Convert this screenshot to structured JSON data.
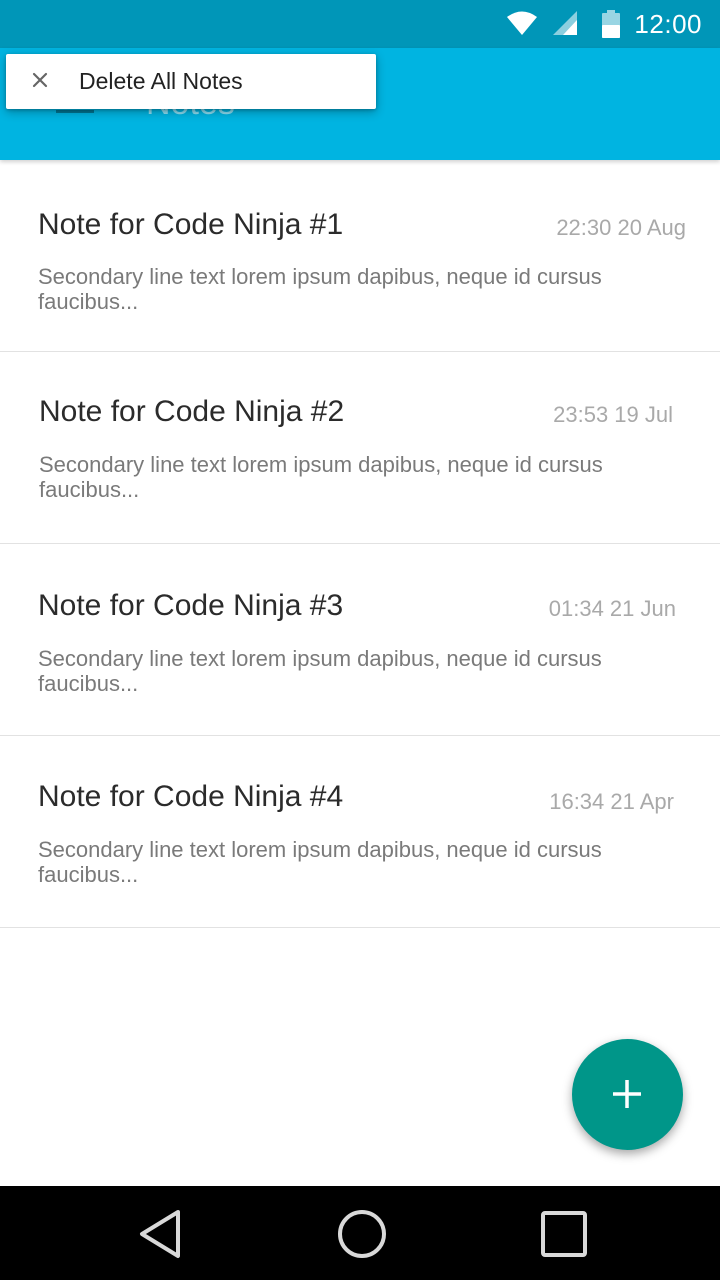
{
  "status_bar": {
    "time": "12:00",
    "icons": [
      "wifi-icon",
      "signal-icon",
      "battery-icon"
    ]
  },
  "app_bar": {
    "title": "Notes",
    "menu_icon": "menu-icon"
  },
  "popup_menu": {
    "close_icon": "close-icon",
    "action_label": "Delete All Notes"
  },
  "notes": [
    {
      "title": "Note for Code Ninja #1",
      "time": "22:30 20 Aug",
      "body": "Secondary line text lorem ipsum dapibus, neque id cursus faucibus..."
    },
    {
      "title": "Note for Code Ninja #2",
      "time": "23:53 19 Jul",
      "body": "Secondary line text lorem ipsum dapibus, neque id cursus faucibus..."
    },
    {
      "title": "Note for Code Ninja #3",
      "time": "01:34 21 Jun",
      "body": "Secondary line text lorem ipsum dapibus, neque id cursus faucibus..."
    },
    {
      "title": "Note for Code Ninja #4",
      "time": "16:34 21 Apr",
      "body": "Secondary line text lorem ipsum dapibus, neque id cursus faucibus..."
    }
  ],
  "fab": {
    "icon": "plus-icon"
  },
  "nav_bar": {
    "icons": [
      "back-icon",
      "home-icon",
      "recents-icon"
    ]
  },
  "colors": {
    "status_bar": "#0096b8",
    "app_bar": "#00b4e1",
    "fab": "#009689",
    "nav_bar": "#000000"
  }
}
